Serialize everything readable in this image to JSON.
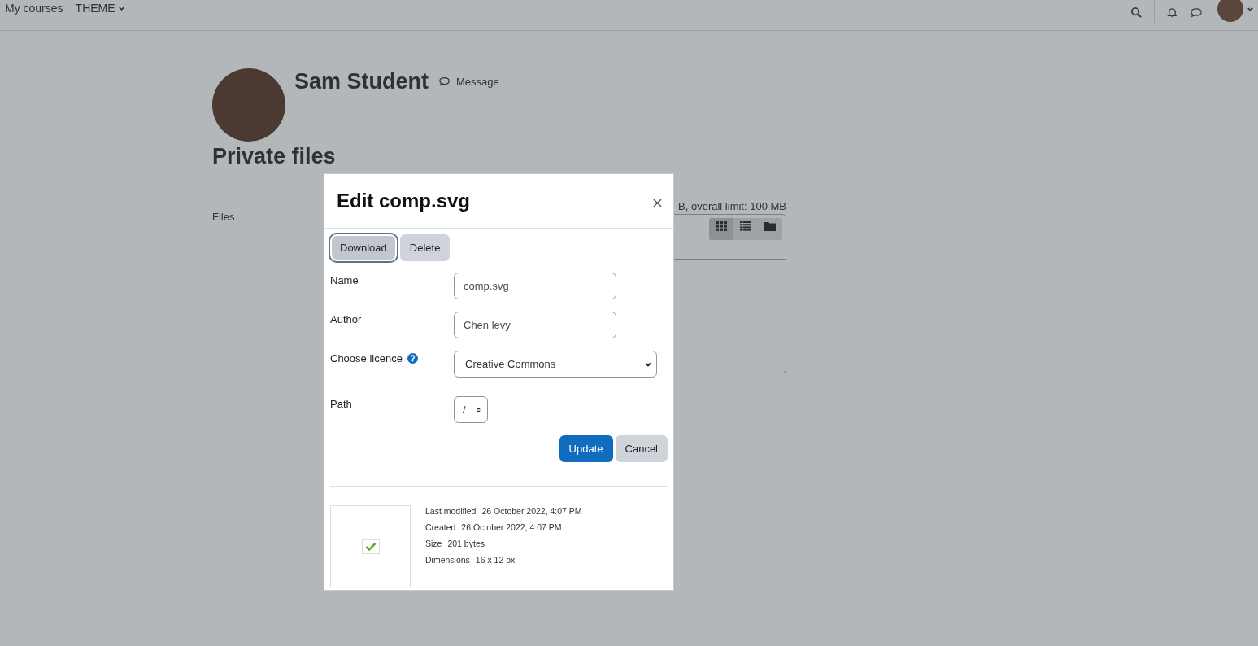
{
  "navbar": {
    "links": [
      {
        "label": "My courses",
        "has_menu": false
      },
      {
        "label": "THEME",
        "has_menu": true
      }
    ]
  },
  "profile": {
    "name": "Sam Student",
    "message_link": "Message"
  },
  "page_title": "Private files",
  "files_section": {
    "label": "Files",
    "limit_text": "B, overall limit: 100 MB",
    "views": [
      {
        "kind": "grid",
        "selected": true
      },
      {
        "kind": "list",
        "selected": false
      },
      {
        "kind": "tree",
        "selected": false
      }
    ]
  },
  "dialog": {
    "title": "Edit comp.svg",
    "actions": [
      {
        "label": "Download",
        "focused": true
      },
      {
        "label": "Delete",
        "focused": false
      }
    ],
    "fields": [
      {
        "kind": "text",
        "label": "Name",
        "value": "comp.svg",
        "help": false
      },
      {
        "kind": "text",
        "label": "Author",
        "value": "Chen levy",
        "help": false
      },
      {
        "kind": "select",
        "label": "Choose licence",
        "value": "Creative Commons",
        "help": true
      },
      {
        "kind": "spinner",
        "label": "Path",
        "value": "/",
        "help": false
      }
    ],
    "buttons": [
      {
        "label": "Update",
        "primary": true
      },
      {
        "label": "Cancel",
        "primary": false
      }
    ],
    "details": [
      {
        "label": "Last modified",
        "value": "26 October 2022, 4:07 PM"
      },
      {
        "label": "Created",
        "value": "26 October 2022, 4:07 PM"
      },
      {
        "label": "Size",
        "value": "201 bytes"
      },
      {
        "label": "Dimensions",
        "value": "16 x 12 px"
      }
    ]
  }
}
